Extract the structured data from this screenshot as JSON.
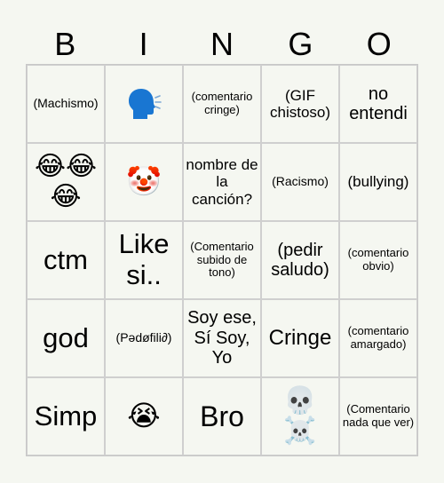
{
  "header": {
    "letters": [
      "B",
      "I",
      "N",
      "G",
      "O"
    ]
  },
  "cells": [
    [
      "(Machismo)",
      "speaking-head-icon",
      "(comentario cringe)",
      "(GIF chistoso)",
      "no entendi"
    ],
    [
      "😂😂😂",
      "🤡",
      "nombre de la canción?",
      "(Racismo)",
      "(bullying)"
    ],
    [
      "ctm",
      "Like si..",
      "(Comentario subido de tono)",
      "(pedir saludo)",
      "(comentario obvio)"
    ],
    [
      "god",
      "(Pədøfili∂)",
      "Soy ese, Sí Soy, Yo",
      "Cringe",
      "(comentario amargado)"
    ],
    [
      "Simp",
      "😭",
      "Bro",
      "💀☠️",
      "(Comentario nada que ver)"
    ]
  ],
  "colors": {
    "background": "#f5f7f1",
    "border": "#cfcfcf",
    "speak_icon": "#1976d2"
  }
}
